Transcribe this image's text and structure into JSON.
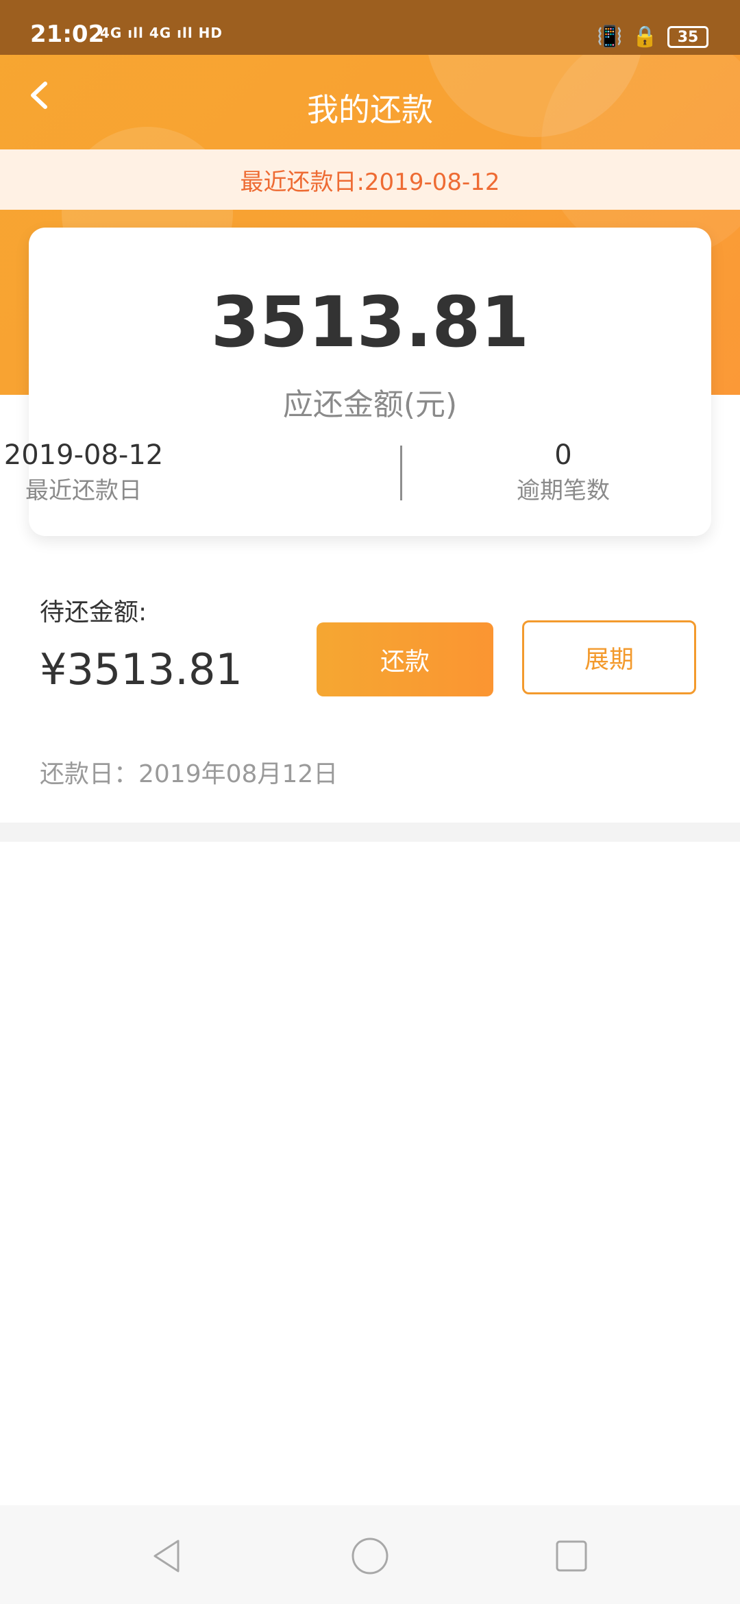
{
  "status_bar": {
    "time": "21:02",
    "network": "4G ıll 4G ıll HD",
    "battery": "35",
    "icons": [
      "vibrate-icon",
      "rotation-lock-icon",
      "battery-icon"
    ]
  },
  "header": {
    "title": "我的还款",
    "back_icon": "chevron-left-icon"
  },
  "notice": {
    "text": "最近还款日:2019-08-12"
  },
  "summary_card": {
    "amount": "3513.81",
    "amount_label": "应还金额(元)",
    "recent_date_value": "2019-08-12",
    "recent_date_label": "最近还款日",
    "overdue_value": "0",
    "overdue_label": "逾期笔数"
  },
  "repayment": {
    "due_label": "待还金额:",
    "due_amount": "¥3513.81",
    "pay_button": "还款",
    "extend_button": "展期",
    "pay_date": "还款日：2019年08月12日"
  },
  "colors": {
    "accent": "#f8a133",
    "notice_text": "#ee6b33",
    "notice_bg": "#fff1e4"
  },
  "system_nav": {
    "icons": [
      "back-triangle-icon",
      "home-circle-icon",
      "recents-square-icon"
    ]
  }
}
